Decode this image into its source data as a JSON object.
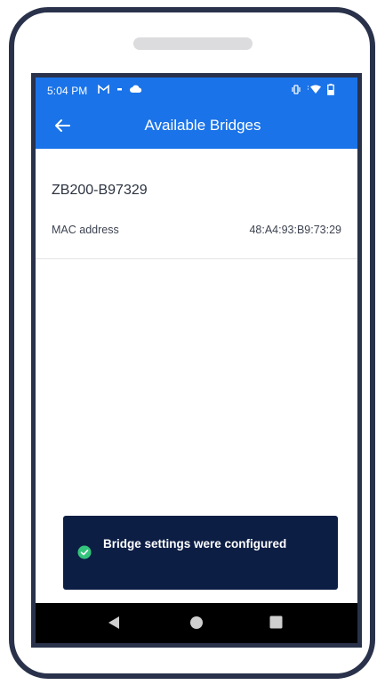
{
  "status_bar": {
    "time": "5:04 PM",
    "left_icons": [
      "gmail-icon",
      "dot-icon",
      "cloud-icon"
    ],
    "right_icons": [
      "vibrate-icon",
      "wifi-icon",
      "battery-icon"
    ]
  },
  "app_bar": {
    "title": "Available Bridges",
    "back_icon": "arrow-left-icon"
  },
  "bridge": {
    "name": "ZB200-B97329",
    "mac_label": "MAC address",
    "mac_value": "48:A4:93:B9:73:29"
  },
  "toast": {
    "message": "Bridge settings were configured",
    "icon": "check-circle-icon",
    "icon_color": "#34c47c",
    "background": "#0d1e45"
  },
  "nav_bar": {
    "buttons": [
      "back-triangle-icon",
      "home-circle-icon",
      "recents-square-icon"
    ]
  },
  "colors": {
    "accent": "#1a73e8",
    "device_frame": "#29324a"
  }
}
